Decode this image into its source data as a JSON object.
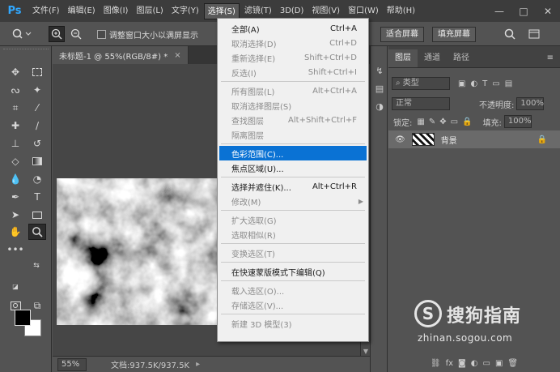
{
  "menubar": {
    "logo": "Ps",
    "items": [
      "文件(F)",
      "编辑(E)",
      "图像(I)",
      "图层(L)",
      "文字(Y)",
      "选择(S)",
      "滤镜(T)",
      "3D(D)",
      "视图(V)",
      "窗口(W)",
      "帮助(H)"
    ],
    "active_index": 5,
    "window_controls": [
      "—",
      "□",
      "✕"
    ]
  },
  "options": {
    "resize_window_label": "调整窗口大小以满屏显示",
    "fit_screen": "适合屏幕",
    "fill_screen": "填充屏幕"
  },
  "document": {
    "tab_title": "未标题-1 @ 55%(RGB/8#) *",
    "close": "×",
    "zoom": "55%",
    "doc_info": "文档:937.5K/937.5K",
    "status_arrow": "▸"
  },
  "select_menu": {
    "items": [
      {
        "label": "全部(A)",
        "shortcut": "Ctrl+A",
        "enabled": true
      },
      {
        "label": "取消选择(D)",
        "shortcut": "Ctrl+D",
        "enabled": false
      },
      {
        "label": "重新选择(E)",
        "shortcut": "Shift+Ctrl+D",
        "enabled": false
      },
      {
        "label": "反选(I)",
        "shortcut": "Shift+Ctrl+I",
        "enabled": false
      },
      {
        "separator": true
      },
      {
        "label": "所有图层(L)",
        "shortcut": "Alt+Ctrl+A",
        "enabled": false
      },
      {
        "label": "取消选择图层(S)",
        "shortcut": "",
        "enabled": false
      },
      {
        "label": "查找图层",
        "shortcut": "Alt+Shift+Ctrl+F",
        "enabled": false
      },
      {
        "label": "隔离图层",
        "shortcut": "",
        "enabled": false
      },
      {
        "separator": true
      },
      {
        "label": "色彩范围(C)...",
        "shortcut": "",
        "enabled": true,
        "highlighted": true
      },
      {
        "label": "焦点区域(U)...",
        "shortcut": "",
        "enabled": true
      },
      {
        "separator": true
      },
      {
        "label": "选择并遮住(K)...",
        "shortcut": "Alt+Ctrl+R",
        "enabled": true
      },
      {
        "label": "修改(M)",
        "shortcut": "",
        "enabled": false,
        "submenu": true
      },
      {
        "separator": true
      },
      {
        "label": "扩大选取(G)",
        "shortcut": "",
        "enabled": false
      },
      {
        "label": "选取相似(R)",
        "shortcut": "",
        "enabled": false
      },
      {
        "separator": true
      },
      {
        "label": "变换选区(T)",
        "shortcut": "",
        "enabled": false
      },
      {
        "separator": true
      },
      {
        "label": "在快速蒙版模式下编辑(Q)",
        "shortcut": "",
        "enabled": true
      },
      {
        "separator": true
      },
      {
        "label": "载入选区(O)...",
        "shortcut": "",
        "enabled": false
      },
      {
        "label": "存储选区(V)...",
        "shortcut": "",
        "enabled": false
      },
      {
        "separator": true
      },
      {
        "label": "新建 3D 模型(3)",
        "shortcut": "",
        "enabled": false
      }
    ]
  },
  "layers_panel": {
    "tabs": [
      "图层",
      "通道",
      "路径"
    ],
    "active_tab": 0,
    "menu_icon": "≡",
    "kind_filter": "类型",
    "blend_mode": "正常",
    "opacity_label": "不透明度:",
    "opacity_value": "100%",
    "lock_label": "锁定:",
    "fill_label": "填充:",
    "fill_value": "100%",
    "layer_name": "背景",
    "footer_icons": [
      "⛓",
      "fx",
      "◙",
      "◐",
      "▭",
      "▣",
      "🗑"
    ]
  },
  "watermark": {
    "logo": "S",
    "brand": "搜狗指南",
    "url": "zhinan.sogou.com"
  }
}
